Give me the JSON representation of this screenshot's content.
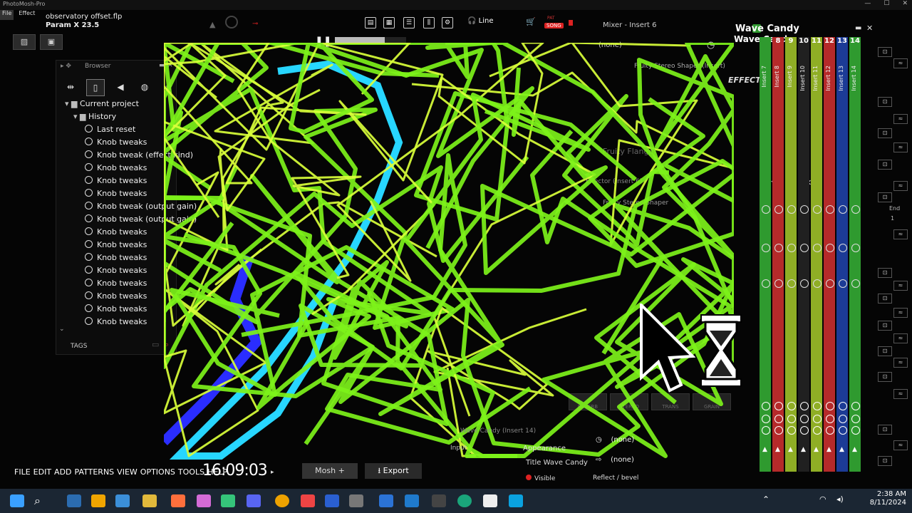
{
  "app": {
    "title": "PhotoMosh-Pro",
    "menu": [
      "File",
      "Effect"
    ],
    "file_name": "observatory offset.flp",
    "param": "Param X 23.5"
  },
  "toolbar": {
    "line_label": "Line",
    "song_label": "SONG",
    "bpm_label": "PAT"
  },
  "playback": {
    "progress": 0.7
  },
  "browser": {
    "title": "Browser",
    "tree": [
      {
        "label": "Current project",
        "level": 0,
        "type": "folder"
      },
      {
        "label": "History",
        "level": 1,
        "type": "folder"
      },
      {
        "label": "Last reset",
        "level": 2,
        "type": "clock"
      },
      {
        "label": "Knob tweaks",
        "level": 2,
        "type": "clock"
      },
      {
        "label": "Knob tweak (effect kind)",
        "level": 2,
        "type": "clock"
      },
      {
        "label": "Knob tweaks",
        "level": 2,
        "type": "clock"
      },
      {
        "label": "Knob tweaks",
        "level": 2,
        "type": "clock"
      },
      {
        "label": "Knob tweaks",
        "level": 2,
        "type": "clock"
      },
      {
        "label": "Knob tweak (output gain)",
        "level": 2,
        "type": "clock"
      },
      {
        "label": "Knob tweak (output gain)",
        "level": 2,
        "type": "clock"
      },
      {
        "label": "Knob tweaks",
        "level": 2,
        "type": "clock"
      },
      {
        "label": "Knob tweaks",
        "level": 2,
        "type": "clock"
      },
      {
        "label": "Knob tweaks",
        "level": 2,
        "type": "clock"
      },
      {
        "label": "Knob tweaks",
        "level": 2,
        "type": "clock"
      },
      {
        "label": "Knob tweaks",
        "level": 2,
        "type": "clock"
      },
      {
        "label": "Knob tweaks",
        "level": 2,
        "type": "clock"
      },
      {
        "label": "Knob tweaks",
        "level": 2,
        "type": "clock"
      },
      {
        "label": "Knob tweaks",
        "level": 2,
        "type": "clock"
      }
    ],
    "tags_label": "TAGS"
  },
  "mixer": {
    "header": "Mixer - Insert 6",
    "title": "Wave Candy",
    "subtitle": "Wave Candy",
    "effects_label": "EFFECTS",
    "slot_none": "(none)",
    "fx_slots": [
      "Fruity Stereo Shaper (Insert)",
      "Fruity Flanger",
      "Effector (Insert 6)",
      "Fruity Stereo Shaper"
    ],
    "strips": [
      {
        "num": "",
        "name": "Insert 7",
        "color": "#2f9a2f"
      },
      {
        "num": "8",
        "name": "Insert 8",
        "color": "#b52a2a"
      },
      {
        "num": "9",
        "name": "Insert 9",
        "color": "#8fae25"
      },
      {
        "num": "10",
        "name": "Insert 10",
        "color": "#202020"
      },
      {
        "num": "11",
        "name": "Insert 11",
        "color": "#8fae25"
      },
      {
        "num": "12",
        "name": "Insert 12",
        "color": "#b52a2a"
      },
      {
        "num": "13",
        "name": "Insert 13",
        "color": "#1c3b96"
      },
      {
        "num": "14",
        "name": "Insert 14",
        "color": "#2f9a2f"
      }
    ],
    "rightbar_label": "End",
    "rightbar_value": "1"
  },
  "reverb_buttons": [
    "REVERB",
    "STEREO",
    "TRANS",
    "GRAIN"
  ],
  "bottom_panel": {
    "slot_a": "(none)",
    "slot_b": "(none)",
    "appearance_label": "Appearance",
    "title_label": "Title",
    "title_value": "Wave Candy",
    "visible_label": "Visible",
    "reflect_label": "Reflect / bevel",
    "input_label": "Input",
    "insert_label": "Wave Candy (Insert 14)"
  },
  "bottom_menu": [
    "FILE",
    "EDIT",
    "ADD",
    "PATTERNS",
    "VIEW",
    "OPTIONS",
    "TOOLS",
    "HELP"
  ],
  "time_display": "16:09:03",
  "mosh_label": "Mosh",
  "export_label": "Export",
  "taskbar": {
    "time": "2:38 AM",
    "date": "8/11/2024"
  },
  "colors": {
    "scribble": "#7df21a",
    "scribble_core": "#d9ff3a",
    "accent_red": "#d22222"
  }
}
